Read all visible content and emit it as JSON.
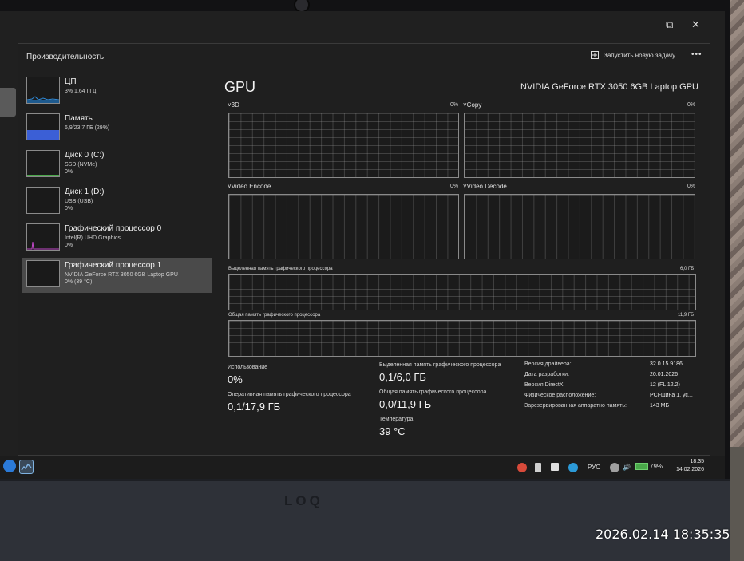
{
  "window": {
    "title": "Производительность",
    "new_task_label": "Запустить новую задачу",
    "more_label": "•••",
    "minimize": "—",
    "maximize": "⧉",
    "close": "✕"
  },
  "sidebar": {
    "items": [
      {
        "name": "ЦП",
        "line1": "3% 1,64 ГГц",
        "line2": "",
        "selected": false
      },
      {
        "name": "Память",
        "line1": "6,9/23,7 ГБ (29%)",
        "line2": "",
        "selected": false
      },
      {
        "name": "Диск 0 (C:)",
        "line1": "SSD (NVMe)",
        "line2": "0%",
        "selected": false
      },
      {
        "name": "Диск 1 (D:)",
        "line1": "USB (USB)",
        "line2": "0%",
        "selected": false
      },
      {
        "name": "Графический процессор 0",
        "line1": "Intel(R) UHD Graphics",
        "line2": "0%",
        "selected": false
      },
      {
        "name": "Графический процессор 1",
        "line1": "NVIDIA GeForce RTX 3050 6GB Laptop GPU",
        "line2": "0% (39 °C)",
        "selected": true
      }
    ]
  },
  "main": {
    "title": "GPU",
    "model": "NVIDIA GeForce RTX 3050 6GB Laptop GPU",
    "engines": [
      {
        "label": "3D",
        "value": "0%"
      },
      {
        "label": "Copy",
        "value": "0%"
      },
      {
        "label": "Video Encode",
        "value": "0%"
      },
      {
        "label": "Video Decode",
        "value": "0%"
      }
    ],
    "dedicated_graph_label": "Выделенная память графического процессора",
    "dedicated_graph_max": "6,0 ГБ",
    "shared_graph_label": "Общая память графического процессора",
    "shared_graph_max": "11,9 ГБ",
    "stats": {
      "usage_label": "Использование",
      "usage_value": "0%",
      "ram_label": "Оперативная память графического процессора",
      "ram_value": "0,1/17,9 ГБ",
      "dedicated_label": "Выделенная память графического процессора",
      "dedicated_value": "0,1/6,0 ГБ",
      "shared_label": "Общая память графического процессора",
      "shared_value": "0,0/11,9 ГБ",
      "temp_label": "Температура",
      "temp_value": "39 °C"
    },
    "details": [
      {
        "key": "Версия драйвера:",
        "value": "32.0.15.9186"
      },
      {
        "key": "Дата разработки:",
        "value": "20.01.2026"
      },
      {
        "key": "Версия DirectX:",
        "value": "12 (FL 12.2)"
      },
      {
        "key": "Физическое расположение:",
        "value": "PCI-шина 1, ус..."
      },
      {
        "key": "Зарезервированная аппаратно память:",
        "value": "143 МБ"
      }
    ]
  },
  "taskbar": {
    "language": "РУС",
    "battery": "79%",
    "time": "18:35",
    "date": "14.02.2026"
  },
  "device": {
    "logo": "LOQ",
    "photo_timestamp": "2026.02.14 18:35:35"
  },
  "colors": {
    "cpu_accent": "#2f8ad8",
    "memory_accent": "#3b5fd6",
    "disk_accent": "#4aa84a",
    "gpu_accent": "#c048c8",
    "selected_bg": "#4a4a4a"
  }
}
